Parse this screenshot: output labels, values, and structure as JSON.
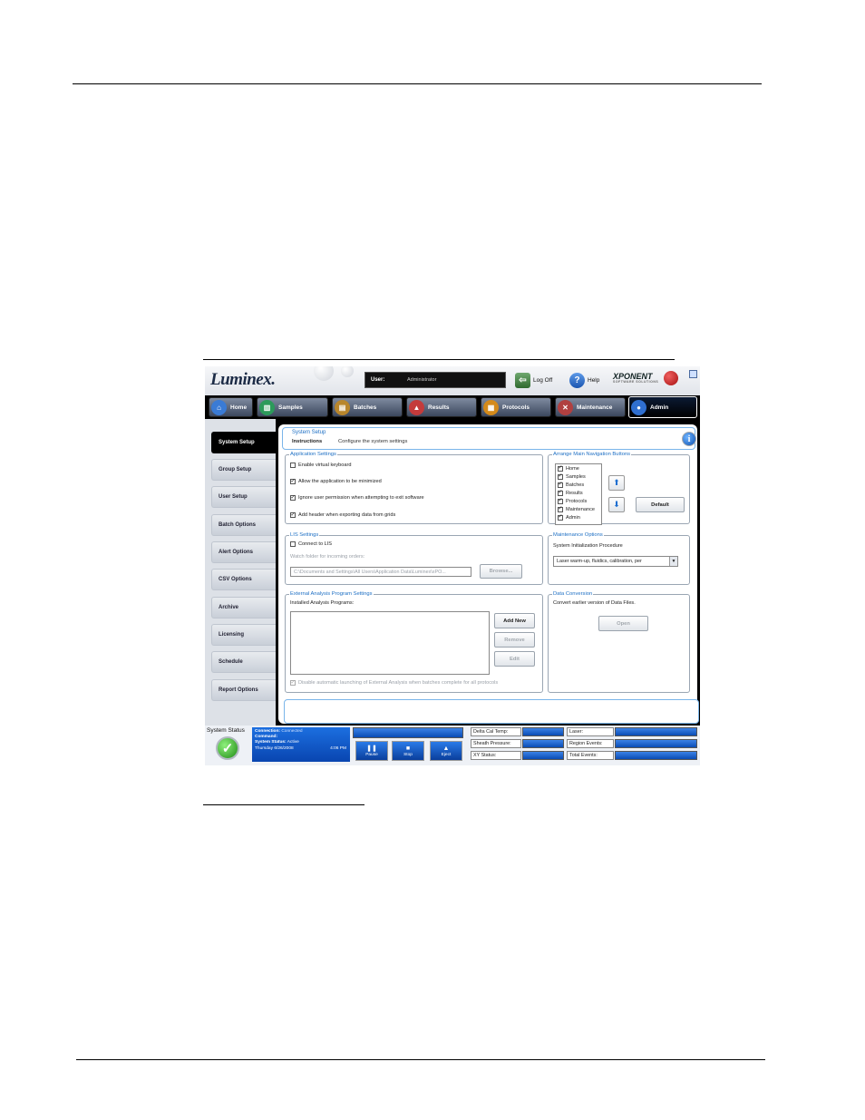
{
  "topbar": {
    "logo": "Luminex.",
    "user_label": "User:",
    "user_value": "Administrator",
    "logoff_label": "Log Off",
    "help_label": "Help",
    "brand": "XPONENT",
    "brand_sub": "SOFTWARE SOLUTIONS"
  },
  "nav": {
    "tabs": [
      {
        "label": "Home",
        "icon": "home-icon",
        "color": "#3a7bd5"
      },
      {
        "label": "Samples",
        "icon": "samples-icon",
        "color": "#2c9a5a"
      },
      {
        "label": "Batches",
        "icon": "batches-icon",
        "color": "#b8862c"
      },
      {
        "label": "Results",
        "icon": "results-icon",
        "color": "#c43b3b"
      },
      {
        "label": "Protocols",
        "icon": "protocols-icon",
        "color": "#d48a1a"
      },
      {
        "label": "Maintenance",
        "icon": "maintenance-icon",
        "color": "#b04040"
      },
      {
        "label": "Admin",
        "icon": "admin-icon",
        "color": "#2f6fd0"
      }
    ]
  },
  "sidebar": {
    "items": [
      {
        "label": "System Setup"
      },
      {
        "label": "Group Setup"
      },
      {
        "label": "User Setup"
      },
      {
        "label": "Batch Options"
      },
      {
        "label": "Alert Options"
      },
      {
        "label": "CSV Options"
      },
      {
        "label": "Archive"
      },
      {
        "label": "Licensing"
      },
      {
        "label": "Schedule"
      },
      {
        "label": "Report Options"
      }
    ]
  },
  "header": {
    "title": "System Setup",
    "instructions_label": "Instructions",
    "instructions_value": "Configure the system settings"
  },
  "app_settings": {
    "legend": "Application Settings",
    "options": [
      {
        "label": "Enable virtual keyboard",
        "checked": false
      },
      {
        "label": "Allow the application to be minimized",
        "checked": true
      },
      {
        "label": "Ignore user permission when attempting to exit software",
        "checked": true
      },
      {
        "label": "Add header when exporting data from grids",
        "checked": true
      }
    ]
  },
  "nav_buttons": {
    "legend": "Arrange Main Navigation Buttons",
    "items": [
      {
        "label": "Home",
        "checked": true
      },
      {
        "label": "Samples",
        "checked": true
      },
      {
        "label": "Batches",
        "checked": true
      },
      {
        "label": "Results",
        "checked": true
      },
      {
        "label": "Protocols",
        "checked": true
      },
      {
        "label": "Maintenance",
        "checked": true
      },
      {
        "label": "Admin",
        "checked": true
      }
    ],
    "default_label": "Default"
  },
  "lis": {
    "legend": "LIS Settings",
    "connect_label": "Connect to LIS",
    "connect_checked": false,
    "watch_label": "Watch folder for incoming orders:",
    "path_value": "C:\\Documents and Settings\\All Users\\Application Data\\Luminex\\xPO...",
    "browse_label": "Browse..."
  },
  "maintenance": {
    "legend": "Maintenance Options",
    "procedure_label": "System Initialization Procedure",
    "procedure_value": "Laser warm-up, fluidics, calibration, per"
  },
  "external": {
    "legend": "External Analysis Program Settings",
    "installed_label": "Installed Analysis Programs:",
    "add_new": "Add New",
    "remove": "Remove",
    "edit": "Edit",
    "disable_label": "Disable automatic launching of External Analysis when batches complete for all protocols",
    "disable_checked": true
  },
  "conversion": {
    "legend": "Data Conversion",
    "text": "Convert earlier version of Data Files.",
    "open_label": "Open"
  },
  "status": {
    "label": "System Status",
    "connection_label": "Connection:",
    "connection_value": "Connected",
    "command_label": "Command:",
    "command_value": "",
    "system_status_label": "System Status:",
    "system_status_value": "Active",
    "date": "Thursday 6/26/2008",
    "time": "4:06 PM",
    "pause": "Pause",
    "stop": "Stop",
    "eject": "Eject",
    "delta_cal_temp": "Delta Cal Temp:",
    "sheath_pressure": "Sheath Pressure:",
    "xy_status": "XY Status:",
    "laser": "Laser:",
    "region_events": "Region Events:",
    "total_events": "Total Events:"
  }
}
